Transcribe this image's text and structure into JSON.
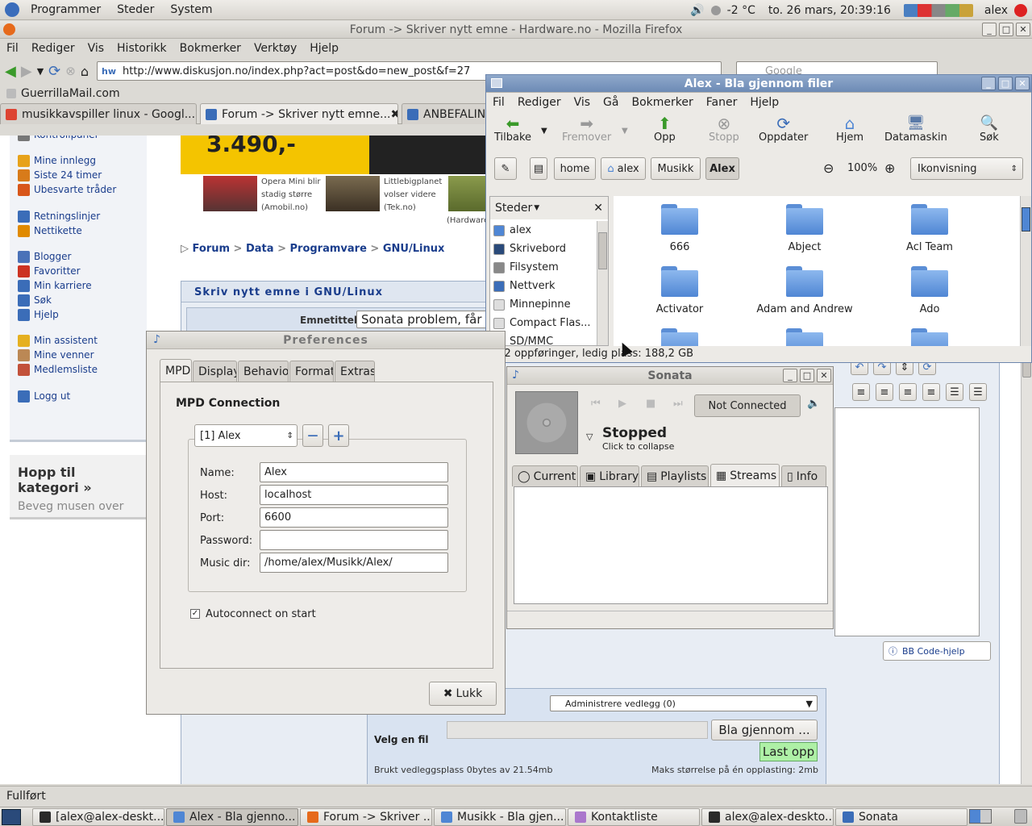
{
  "top_panel": {
    "menus": [
      "Programmer",
      "Steder",
      "System"
    ],
    "temp": "-2 °C",
    "datetime": "to. 26 mars, 20:39:16",
    "user": "alex"
  },
  "firefox": {
    "title": "Forum -> Skriver nytt emne - Hardware.no - Mozilla Firefox",
    "menu": [
      "Fil",
      "Rediger",
      "Vis",
      "Historikk",
      "Bokmerker",
      "Verktøy",
      "Hjelp"
    ],
    "url": "http://www.diskusjon.no/index.php?act=post&do=new_post&f=27",
    "search_placeholder": "Google",
    "bookmark": "GuerrillaMail.com",
    "tabs": [
      "musikkavspiller linux - Googl...",
      "Forum -> Skriver nytt emne...",
      "ANBEFALING"
    ],
    "status": "Fullført"
  },
  "page": {
    "sidebar": [
      "Kontrollpanel",
      "Mine innlegg",
      "Siste 24 timer",
      "Ubesvarte tråder",
      "Retningslinjer",
      "Nettikette",
      "Blogger",
      "Favoritter",
      "Min karriere",
      "Søk",
      "Hjelp",
      "Min assistent",
      "Mine venner",
      "Medlemsliste",
      "Logg ut"
    ],
    "hopp_title": "Hopp til kategori »",
    "hopp_sub": "Beveg musen over",
    "price": "3.490,-",
    "news": [
      {
        "l1": "Opera Mini blir",
        "l2": "stadig større",
        "l3": "(Amobil.no)"
      },
      {
        "l1": "Littlebigplanet",
        "l2": "volser videre",
        "l3": "(Tek.no)"
      },
      {
        "l1": "",
        "l2": "",
        "l3": "(Hardware"
      }
    ],
    "breadcrumb": [
      "Forum",
      "Data",
      "Programvare",
      "GNU/Linux"
    ],
    "post_header": "Skriv nytt emne i GNU/Linux",
    "emnetittel_label": "Emnetittel",
    "emnetittel_value": "Sonata problem, får ik",
    "bbcode": "BB Code-hjelp",
    "vedlegg_select": "Administrere vedlegg (0)",
    "velg_fil": "Velg en fil",
    "bla_button": "Bla gjennom ...",
    "last_opp": "Last opp",
    "brukt": "Brukt vedleggsplass 0bytes av 21.54mb",
    "maks": "Maks størrelse på én opplasting: 2mb"
  },
  "nautilus": {
    "title": "Alex - Bla gjennom filer",
    "menu": [
      "Fil",
      "Rediger",
      "Vis",
      "Gå",
      "Bokmerker",
      "Faner",
      "Hjelp"
    ],
    "toolbar": [
      "Tilbake",
      "Fremover",
      "Opp",
      "Stopp",
      "Oppdater",
      "Hjem",
      "Datamaskin",
      "Søk"
    ],
    "path": [
      "home",
      "alex",
      "Musikk",
      "Alex"
    ],
    "zoom": "100%",
    "view": "Ikonvisning",
    "places_title": "Steder",
    "places": [
      "alex",
      "Skrivebord",
      "Filsystem",
      "Nettverk",
      "Minnepinne",
      "Compact Flas...",
      "SD/MMC"
    ],
    "files": [
      "666",
      "Abject",
      "Acl Team",
      "Activator",
      "Adam and Andrew",
      "Ado"
    ],
    "status": "182 oppføringer, ledig plass: 188,2 GB"
  },
  "prefs": {
    "title": "Preferences",
    "tabs": [
      "MPD",
      "Display",
      "Behavior",
      "Format",
      "Extras"
    ],
    "section": "MPD Connection",
    "profile": "[1] Alex",
    "labels": {
      "name": "Name:",
      "host": "Host:",
      "port": "Port:",
      "password": "Password:",
      "musicdir": "Music dir:"
    },
    "values": {
      "name": "Alex",
      "host": "localhost",
      "port": "6600",
      "password": "",
      "musicdir": "/home/alex/Musikk/Alex/"
    },
    "autoconnect": "Autoconnect on start",
    "close": "Lukk"
  },
  "sonata": {
    "title": "Sonata",
    "connect": "Not Connected",
    "state": "Stopped",
    "sub": "Click to collapse",
    "tabs": [
      "Current",
      "Library",
      "Playlists",
      "Streams",
      "Info"
    ]
  },
  "taskbar": [
    "[alex@alex-deskt...",
    "Alex - Bla gjenno...",
    "Forum -> Skriver ...",
    "Musikk - Bla gjen...",
    "Kontaktliste",
    "alex@alex-deskto...",
    "Sonata"
  ]
}
